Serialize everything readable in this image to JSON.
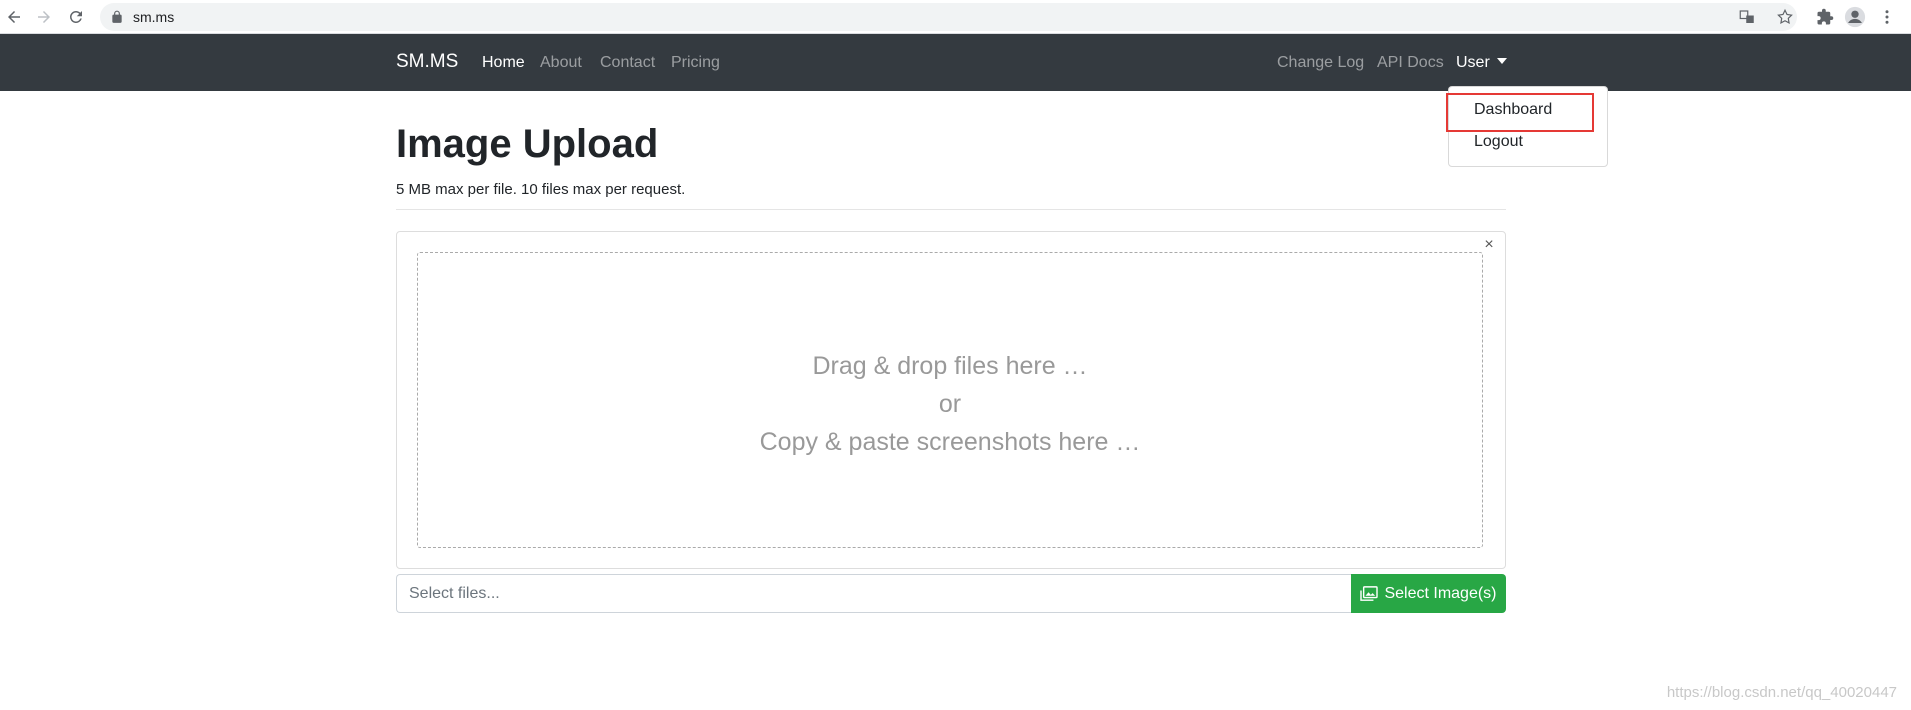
{
  "browser": {
    "url": "sm.ms"
  },
  "navbar": {
    "brand": "SM.MS",
    "left_links": [
      "Home",
      "About",
      "Contact",
      "Pricing"
    ],
    "right_links": [
      "Change Log",
      "API Docs"
    ],
    "user_menu": "User"
  },
  "dropdown": {
    "items": [
      "Dashboard",
      "Logout"
    ],
    "highlighted": "Dashboard"
  },
  "content": {
    "title": "Image Upload",
    "subtitle": "5 MB max per file. 10 files max per request.",
    "close_symbol": "×",
    "drop_zone": {
      "line1": "Drag & drop files here …",
      "line2": "or",
      "line3": "Copy & paste screenshots here …"
    },
    "file_input_placeholder": "Select files...",
    "select_button": "Select Image(s)"
  },
  "watermark": "https://blog.csdn.net/qq_40020447",
  "colors": {
    "navbar_bg": "#343a40",
    "success_green": "#28a745",
    "highlight_red": "#e53935"
  }
}
